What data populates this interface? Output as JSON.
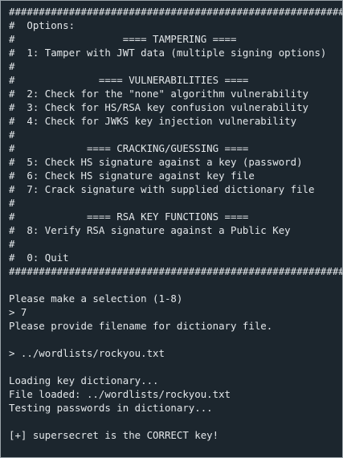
{
  "terminal": {
    "lines": [
      "##############################################################",
      "#  Options:                                                  #",
      "#                  ==== TAMPERING ====                       #",
      "#  1: Tamper with JWT data (multiple signing options)        #",
      "#                                                            #",
      "#              ==== VULNERABILITIES ====                     #",
      "#  2: Check for the \"none\" algorithm vulnerability           #",
      "#  3: Check for HS/RSA key confusion vulnerability           #",
      "#  4: Check for JWKS key injection vulnerability             #",
      "#                                                            #",
      "#            ==== CRACKING/GUESSING ====                     #",
      "#  5: Check HS signature against a key (password)            #",
      "#  6: Check HS signature against key file                    #",
      "#  7: Crack signature with supplied dictionary file          #",
      "#                                                            #",
      "#            ==== RSA KEY FUNCTIONS ====                     #",
      "#  8: Verify RSA signature against a Public Key              #",
      "#                                                            #",
      "#  0: Quit                                                   #",
      "##############################################################",
      "",
      "Please make a selection (1-8)",
      "> 7",
      "Please provide filename for dictionary file.",
      "",
      "> ../wordlists/rockyou.txt",
      "",
      "Loading key dictionary...",
      "File loaded: ../wordlists/rockyou.txt",
      "Testing passwords in dictionary...",
      "",
      "[+] supersecret is the CORRECT key!"
    ]
  }
}
